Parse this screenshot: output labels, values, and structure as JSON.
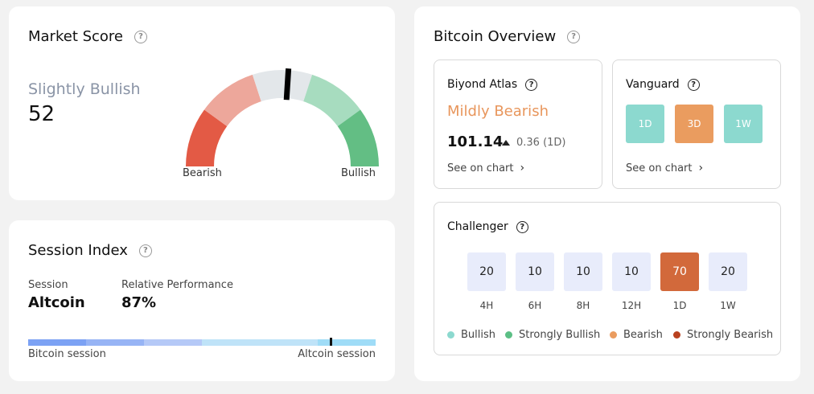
{
  "market_score": {
    "title": "Market Score",
    "sentiment": "Slightly Bullish",
    "value": "52",
    "score": 52,
    "left_label": "Bearish",
    "right_label": "Bullish",
    "colors": [
      "#e35a45",
      "#eda79b",
      "#e3e7ea",
      "#a7dcbf",
      "#63be84"
    ]
  },
  "session_index": {
    "title": "Session Index",
    "session_label": "Session",
    "session_value": "Altcoin",
    "perf_label": "Relative Performance",
    "perf_value": "87%",
    "performance": 87,
    "left_label": "Bitcoin session",
    "right_label": "Altcoin session",
    "bar_colors": [
      "#7ca2f4",
      "#97b4f5",
      "#b5c9f7",
      "#bfe3f8",
      "#9fdcf7"
    ]
  },
  "bitcoin_overview": {
    "title": "Bitcoin Overview",
    "atlas": {
      "title": "Biyond Atlas",
      "sentiment": "Mildly Bearish",
      "price": "101.14",
      "change": "0.36 (1D)",
      "link": "See on chart"
    },
    "vanguard": {
      "title": "Vanguard",
      "link": "See on chart",
      "timeframes": [
        {
          "label": "1D",
          "color": "#8cd9cf"
        },
        {
          "label": "3D",
          "color": "#ea9c5f"
        },
        {
          "label": "1W",
          "color": "#8cd9cf"
        }
      ]
    },
    "challenger": {
      "title": "Challenger",
      "cells": [
        {
          "value": "20",
          "tf": "4H",
          "active": false
        },
        {
          "value": "10",
          "tf": "6H",
          "active": false
        },
        {
          "value": "10",
          "tf": "8H",
          "active": false
        },
        {
          "value": "10",
          "tf": "12H",
          "active": false
        },
        {
          "value": "70",
          "tf": "1D",
          "active": true
        },
        {
          "value": "20",
          "tf": "1W",
          "active": false
        }
      ],
      "legend": [
        {
          "label": "Bullish",
          "color": "#8cd9cf"
        },
        {
          "label": "Strongly Bullish",
          "color": "#5cbf85"
        },
        {
          "label": "Bearish",
          "color": "#ea9c5f"
        },
        {
          "label": "Strongly Bearish",
          "color": "#b9411f"
        }
      ]
    }
  }
}
